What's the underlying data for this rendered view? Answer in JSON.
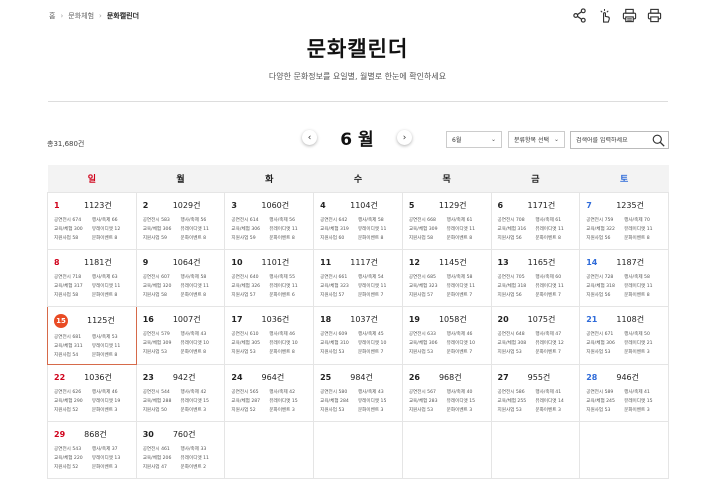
{
  "breadcrumb": {
    "home": "홈",
    "section": "문화체험",
    "current": "문화캘린더"
  },
  "tools": [
    "share-icon",
    "gesture-icon",
    "print-preview-icon",
    "print-icon"
  ],
  "page": {
    "title": "문화캘린더",
    "subtitle": "다양한 문화정보를 요일별, 월별로 한눈에 확인하세요"
  },
  "summary": {
    "total": "총31,680건"
  },
  "month_nav": {
    "prev": "‹",
    "label": "6 월",
    "next": "›"
  },
  "filters": {
    "month": "6월",
    "category": "분류항목 선택",
    "search_placeholder": "검색어를 입력하세요"
  },
  "weekdays": [
    "일",
    "월",
    "화",
    "수",
    "목",
    "금",
    "토"
  ],
  "weeks": [
    [
      {
        "day": "1",
        "count": "1123건",
        "c": [
          "공연전시 674",
          "행사/축제 66",
          "교육/체험 300",
          "뮤레이디앳 12",
          "지원사업 58",
          "문화이벤트 8"
        ]
      },
      {
        "day": "2",
        "count": "1029건",
        "c": [
          "공연전시 583",
          "행사/축제 56",
          "교육/체험 306",
          "뮤레이디앳 11",
          "지원사업 59",
          "문화이벤트 8"
        ]
      },
      {
        "day": "3",
        "count": "1060건",
        "c": [
          "공연전시 614",
          "행사/축제 56",
          "교육/체험 306",
          "뮤레이디앳 11",
          "지원사업 59",
          "문화이벤트 8"
        ]
      },
      {
        "day": "4",
        "count": "1104건",
        "c": [
          "공연전시 642",
          "행사/축제 58",
          "교육/체험 319",
          "뮤레이디앳 11",
          "지원사업 60",
          "문화이벤트 8"
        ]
      },
      {
        "day": "5",
        "count": "1129건",
        "c": [
          "공연전시 668",
          "행사/축제 61",
          "교육/체험 309",
          "뮤레이디앳 11",
          "지원사업 58",
          "문화이벤트 8"
        ]
      },
      {
        "day": "6",
        "count": "1171건",
        "c": [
          "공연전시 708",
          "행사/축제 61",
          "교육/체험 316",
          "뮤레이디앳 11",
          "지원사업 56",
          "문화이벤트 8"
        ]
      },
      {
        "day": "7",
        "count": "1235건",
        "c": [
          "공연전시 759",
          "행사/축제 70",
          "교육/체험 322",
          "뮤레이디앳 11",
          "지원사업 56",
          "문화이벤트 8"
        ]
      }
    ],
    [
      {
        "day": "8",
        "count": "1181건",
        "c": [
          "공연전시 718",
          "행사/축제 63",
          "교육/체험 317",
          "뮤레이디앳 11",
          "지원사업 58",
          "문화이벤트 8"
        ]
      },
      {
        "day": "9",
        "count": "1064건",
        "c": [
          "공연전시 607",
          "행사/축제 58",
          "교육/체험 320",
          "뮤레이디앳 11",
          "지원사업 58",
          "문화이벤트 8"
        ]
      },
      {
        "day": "10",
        "count": "1101건",
        "c": [
          "공연전시 640",
          "행사/축제 55",
          "교육/체험 326",
          "뮤레이디앳 11",
          "지원사업 57",
          "문화이벤트 6"
        ]
      },
      {
        "day": "11",
        "count": "1117건",
        "c": [
          "공연전시 661",
          "행사/축제 54",
          "교육/체험 323",
          "뮤레이디앳 11",
          "지원사업 57",
          "문화이벤트 7"
        ]
      },
      {
        "day": "12",
        "count": "1145건",
        "c": [
          "공연전시 685",
          "행사/축제 58",
          "교육/체험 323",
          "뮤레이디앳 11",
          "지원사업 57",
          "문화이벤트 7"
        ]
      },
      {
        "day": "13",
        "count": "1165건",
        "c": [
          "공연전시 705",
          "행사/축제 60",
          "교육/체험 318",
          "뮤레이디앳 11",
          "지원사업 56",
          "문화이벤트 7"
        ]
      },
      {
        "day": "14",
        "count": "1187건",
        "c": [
          "공연전시 728",
          "행사/축제 58",
          "교육/체험 318",
          "뮤레이디앳 11",
          "지원사업 56",
          "문화이벤트 8"
        ]
      }
    ],
    [
      {
        "day": "15",
        "count": "1125건",
        "today": true,
        "c": [
          "공연전시 681",
          "행사/축제 53",
          "교육/체험 311",
          "뮤레이디앳 11",
          "지원사업 54",
          "문화이벤트 8"
        ]
      },
      {
        "day": "16",
        "count": "1007건",
        "c": [
          "공연전시 579",
          "행사/축제 43",
          "교육/체험 309",
          "뮤레이디앳 10",
          "지원사업 53",
          "문화이벤트 8"
        ]
      },
      {
        "day": "17",
        "count": "1036건",
        "c": [
          "공연전시 610",
          "행사/축제 46",
          "교육/체험 305",
          "뮤레이디앳 10",
          "지원사업 53",
          "문화이벤트 8"
        ]
      },
      {
        "day": "18",
        "count": "1037건",
        "c": [
          "공연전시 609",
          "행사/축제 45",
          "교육/체험 310",
          "뮤레이디앳 10",
          "지원사업 53",
          "문화이벤트 7"
        ]
      },
      {
        "day": "19",
        "count": "1058건",
        "c": [
          "공연전시 633",
          "행사/축제 46",
          "교육/체험 306",
          "뮤레이디앳 10",
          "지원사업 53",
          "문화이벤트 7"
        ]
      },
      {
        "day": "20",
        "count": "1075건",
        "c": [
          "공연전시 648",
          "행사/축제 47",
          "교육/체험 308",
          "뮤레이디앳 12",
          "지원사업 53",
          "문화이벤트 7"
        ]
      },
      {
        "day": "21",
        "count": "1108건",
        "c": [
          "공연전시 671",
          "행사/축제 50",
          "교육/체험 306",
          "뮤레이디앳 21",
          "지원사업 53",
          "문화이벤트 3"
        ]
      }
    ],
    [
      {
        "day": "22",
        "count": "1036건",
        "c": [
          "공연전시 626",
          "행사/축제 46",
          "교육/체험 290",
          "뮤레이디앳 19",
          "지원사업 52",
          "문화이벤트 3"
        ]
      },
      {
        "day": "23",
        "count": "942건",
        "c": [
          "공연전시 544",
          "행사/축제 42",
          "교육/체험 288",
          "뮤레이디앳 15",
          "지원사업 50",
          "문화이벤트 3"
        ]
      },
      {
        "day": "24",
        "count": "964건",
        "c": [
          "공연전시 565",
          "행사/축제 42",
          "교육/체험 287",
          "뮤레이디앳 15",
          "지원사업 52",
          "문화이벤트 3"
        ]
      },
      {
        "day": "25",
        "count": "984건",
        "c": [
          "공연전시 580",
          "행사/축제 43",
          "교육/체험 284",
          "뮤레이디앳 15",
          "지원사업 53",
          "문화이벤트 3"
        ]
      },
      {
        "day": "26",
        "count": "968건",
        "c": [
          "공연전시 567",
          "행사/축제 40",
          "교육/체험 283",
          "뮤레이디앳 15",
          "지원사업 53",
          "문화이벤트 3"
        ]
      },
      {
        "day": "27",
        "count": "955건",
        "c": [
          "공연전시 586",
          "행사/축제 41",
          "교육/체험 255",
          "뮤레이디앳 14",
          "지원사업 53",
          "문화이벤트 3"
        ]
      },
      {
        "day": "28",
        "count": "946건",
        "c": [
          "공연전시 589",
          "행사/축제 41",
          "교육/체험 245",
          "뮤레이디앳 15",
          "지원사업 53",
          "문화이벤트 3"
        ]
      }
    ],
    [
      {
        "day": "29",
        "count": "868건",
        "c": [
          "공연전시 543",
          "행사/축제 37",
          "교육/체험 220",
          "뮤레이디앳 13",
          "지원사업 52",
          "문화이벤트 3"
        ]
      },
      {
        "day": "30",
        "count": "760건",
        "c": [
          "공연전시 461",
          "행사/축제 33",
          "교육/체험 206",
          "뮤레이디앳 11",
          "지원사업 47",
          "문화이벤트 2"
        ]
      },
      null,
      null,
      null,
      null,
      null
    ]
  ]
}
